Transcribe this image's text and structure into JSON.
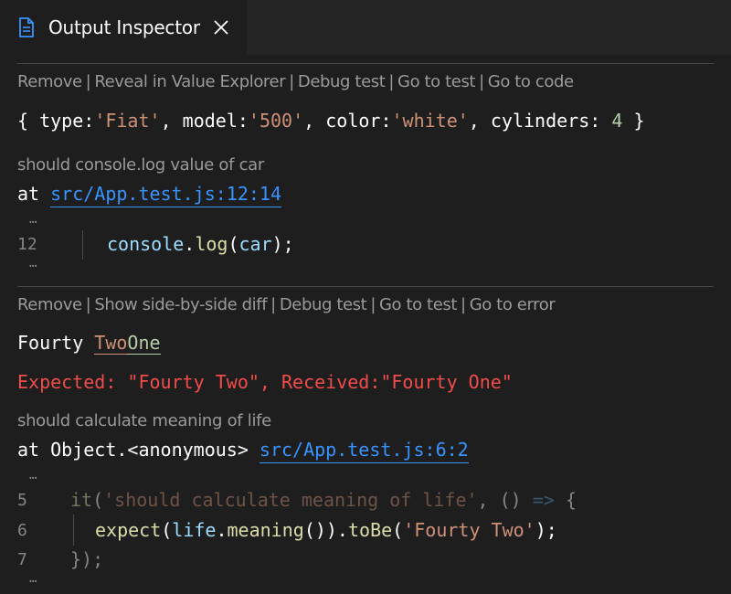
{
  "tab": {
    "title": "Output Inspector",
    "close_glyph": "✕"
  },
  "colors": {
    "background": "#1e1e1e",
    "link": "#3794ff",
    "error": "#f14c4c",
    "string": "#ce9178",
    "number": "#b5cea8"
  },
  "entry1": {
    "actions": [
      "Remove",
      "Reveal in Value Explorer",
      "Debug test",
      "Go to test",
      "Go to code"
    ],
    "value": {
      "open": "{ ",
      "pairs": [
        {
          "key": "type",
          "value": "'Fiat'"
        },
        {
          "key": "model",
          "value": "'500'"
        },
        {
          "key": "color",
          "value": "'white'"
        },
        {
          "key": "cylinders",
          "value": "4"
        }
      ],
      "close": " }"
    },
    "description": "should console.log value of car",
    "location_prefix": "at ",
    "location": "src/App.test.js:12:14",
    "ellipsis": "…",
    "code_line": {
      "number": "12",
      "obj": "console",
      "dot": ".",
      "fn": "log",
      "open": "(",
      "arg": "car",
      "close": ");"
    }
  },
  "entry2": {
    "actions": [
      "Remove",
      "Show side-by-side diff",
      "Debug test",
      "Go to test",
      "Go to error"
    ],
    "diff": {
      "common": "Fourty ",
      "removed": "Two",
      "added": "One"
    },
    "error": "Expected: \"Fourty Two\", Received:\"Fourty One\"",
    "description": "should calculate meaning of life",
    "location_prefix": "at Object.<anonymous> ",
    "location": "src/App.test.js:6:2",
    "ellipsis": "…",
    "code_lines": [
      {
        "number": "5",
        "text": "it('should calculate meaning of life', () => {"
      },
      {
        "number": "6",
        "text": "expect(life.meaning()).toBe('Fourty Two');"
      },
      {
        "number": "7",
        "text": "});"
      }
    ]
  }
}
